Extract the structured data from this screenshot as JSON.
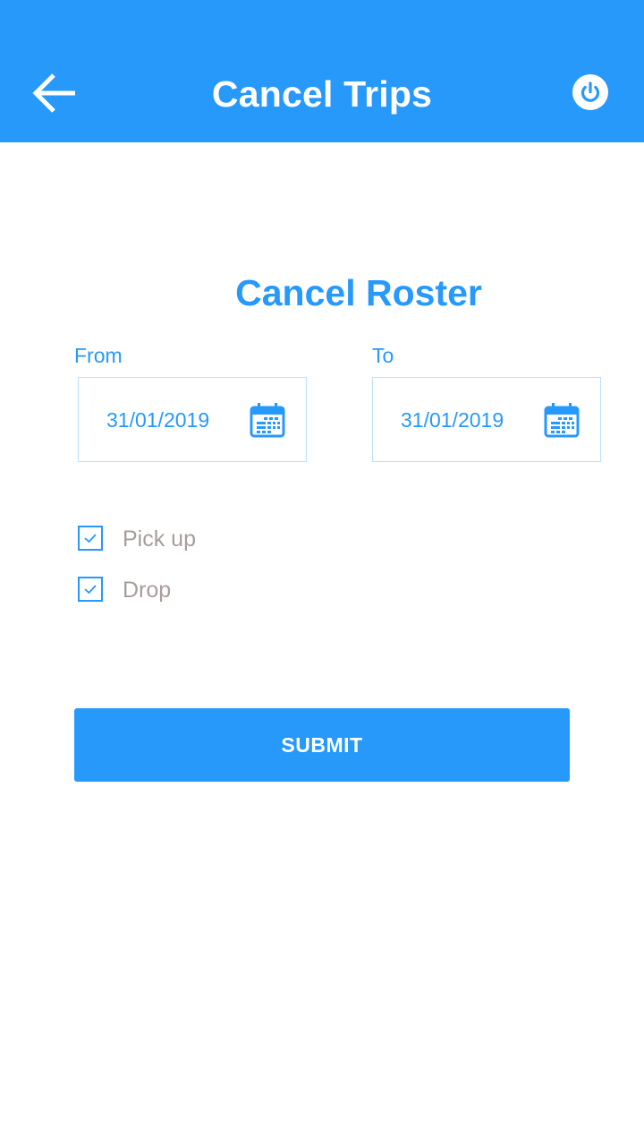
{
  "header": {
    "title": "Cancel Trips",
    "back_icon": "arrow-left-icon",
    "power_icon": "power-icon"
  },
  "main": {
    "section_title": "Cancel Roster",
    "from": {
      "label": "From",
      "value": "31/01/2019",
      "icon": "calendar-icon"
    },
    "to": {
      "label": "To",
      "value": "31/01/2019",
      "icon": "calendar-icon"
    },
    "options": [
      {
        "label": "Pick up",
        "checked": true
      },
      {
        "label": "Drop",
        "checked": true
      }
    ],
    "submit_label": "SUBMIT"
  },
  "colors": {
    "primary": "#2699fb",
    "border": "#bce0fd",
    "option_text": "#a79d9b",
    "background": "#ffffff"
  }
}
